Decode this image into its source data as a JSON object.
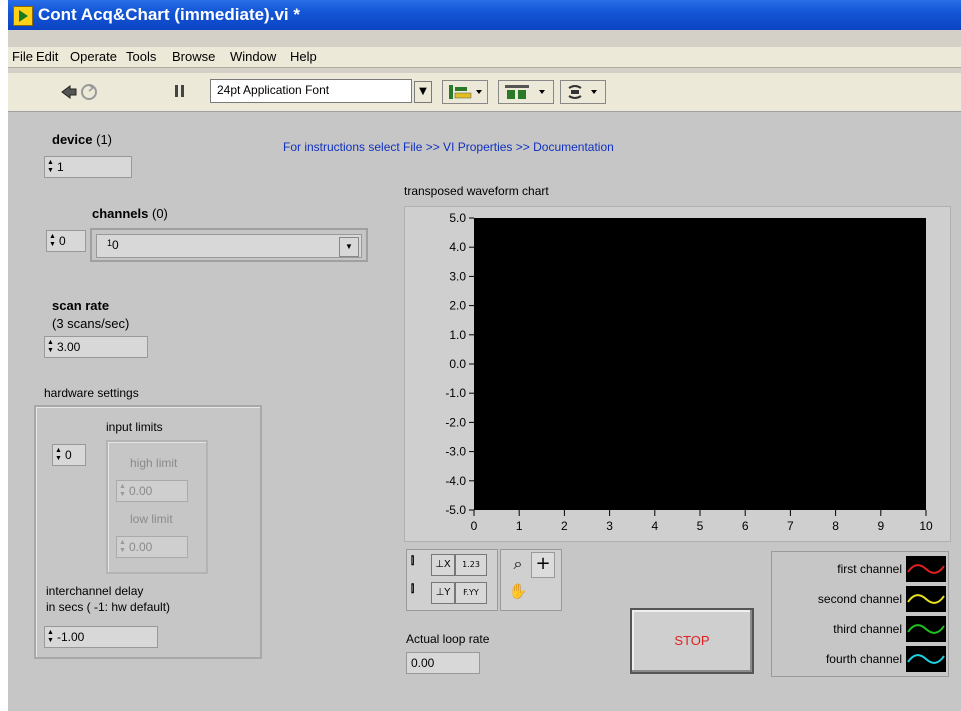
{
  "window": {
    "title": "Cont Acq&Chart (immediate).vi *"
  },
  "menu": [
    "File",
    "Edit",
    "Operate",
    "Tools",
    "Browse",
    "Window",
    "Help"
  ],
  "toolbar": {
    "font": "24pt Application Font",
    "icons": [
      "run-icon",
      "run-continuously-icon",
      "pause-icon",
      "align-objects-icon",
      "distribute-objects-icon",
      "reorder-icon"
    ]
  },
  "controls": {
    "device": {
      "label": "device",
      "suffix": "(1)",
      "value": "1"
    },
    "channels": {
      "label": "channels",
      "suffix": "(0)",
      "index": "0",
      "value": "0"
    },
    "scan_rate": {
      "label": "scan rate",
      "sub": "(3 scans/sec)",
      "value": "3.00"
    },
    "hardware": {
      "label": "hardware settings",
      "input_limits": "input limits",
      "index": "0",
      "high_limit": {
        "label": "high limit",
        "value": "0.00"
      },
      "low_limit": {
        "label": "low limit",
        "value": "0.00"
      },
      "delay_label_1": "interchannel delay",
      "delay_label_2": "in secs ( -1: hw default)",
      "delay_value": "-1.00"
    },
    "instructions": "For instructions select File >> VI Properties >> Documentation",
    "actual_loop_rate": {
      "label": "Actual loop rate",
      "value": "0.00"
    },
    "stop": "STOP"
  },
  "chart_data": {
    "type": "line",
    "title": "transposed waveform chart",
    "xlabel": "",
    "ylabel": "",
    "ylim": [
      -5.0,
      5.0
    ],
    "xlim": [
      0,
      10
    ],
    "y_ticks": [
      "5.0",
      "4.0",
      "3.0",
      "2.0",
      "1.0",
      "0.0",
      "-1.0",
      "-2.0",
      "-3.0",
      "-4.0",
      "-5.0"
    ],
    "x_ticks": [
      "0",
      "1",
      "2",
      "3",
      "4",
      "5",
      "6",
      "7",
      "8",
      "9",
      "10"
    ],
    "background": "#000000",
    "series": [
      {
        "name": "first channel",
        "color": "#e02020",
        "values": []
      },
      {
        "name": "second channel",
        "color": "#e8e020",
        "values": []
      },
      {
        "name": "third channel",
        "color": "#20c020",
        "values": []
      },
      {
        "name": "fourth channel",
        "color": "#20d0e0",
        "values": []
      }
    ],
    "palette_labels": {
      "x_fmt": "1.23",
      "y_fmt": "F.YY"
    }
  }
}
